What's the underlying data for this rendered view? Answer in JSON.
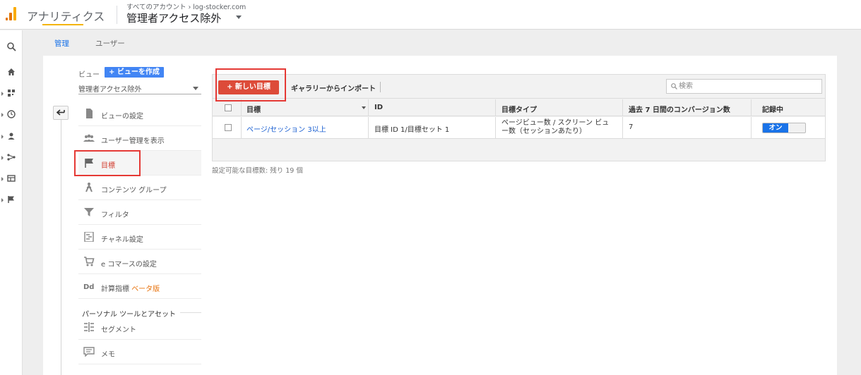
{
  "header": {
    "app_title": "アナリティクス",
    "breadcrumb": "すべてのアカウント › log-stocker.com",
    "view_name": "管理者アクセス除外"
  },
  "tabs": [
    {
      "label": "管理",
      "active": true
    },
    {
      "label": "ユーザー",
      "active": false
    }
  ],
  "view_panel": {
    "label": "ビュー",
    "create_button": "+ ビューを作成",
    "selected_view": "管理者アクセス除外"
  },
  "nav": [
    {
      "label": "ビューの設定",
      "icon": "document-icon"
    },
    {
      "label": "ユーザー管理を表示",
      "icon": "users-icon"
    },
    {
      "label": "目標",
      "icon": "flag-icon",
      "active": true
    },
    {
      "label": "コンテンツ グループ",
      "icon": "person-walk-icon"
    },
    {
      "label": "フィルタ",
      "icon": "filter-icon"
    },
    {
      "label": "チャネル設定",
      "icon": "channel-icon"
    },
    {
      "label": "e コマースの設定",
      "icon": "cart-icon"
    },
    {
      "label": "計算指標 ",
      "suffix": "ベータ版",
      "icon": "dd-icon"
    }
  ],
  "section_title": "パーソナル ツールとアセット",
  "nav_personal": [
    {
      "label": "セグメント",
      "icon": "segment-icon"
    },
    {
      "label": "メモ",
      "icon": "memo-icon"
    }
  ],
  "toolbar": {
    "new_goal": "+ 新しい目標",
    "import": "ギャラリーからインポート",
    "search_placeholder": "検索"
  },
  "table": {
    "headers": [
      "目標",
      "ID",
      "目標タイプ",
      "過去 7 日間のコンバージョン数",
      "記録中"
    ],
    "rows": [
      {
        "name": "ページ/セッション 3以上",
        "id": "目標 ID 1/目標セット 1",
        "type_line1": "ページビュー数 / スクリーン ビュ",
        "type_line2": "ー数（セッションあたり）",
        "conversions": "7",
        "recording": "オン"
      }
    ]
  },
  "remaining_text": "設定可能な目標数: 残り 19 個",
  "colors": {
    "accent_blue": "#1a73e8",
    "new_goal_red": "#dd4b39",
    "highlight_red": "#e53935",
    "tab_underline": "#f4b400"
  }
}
